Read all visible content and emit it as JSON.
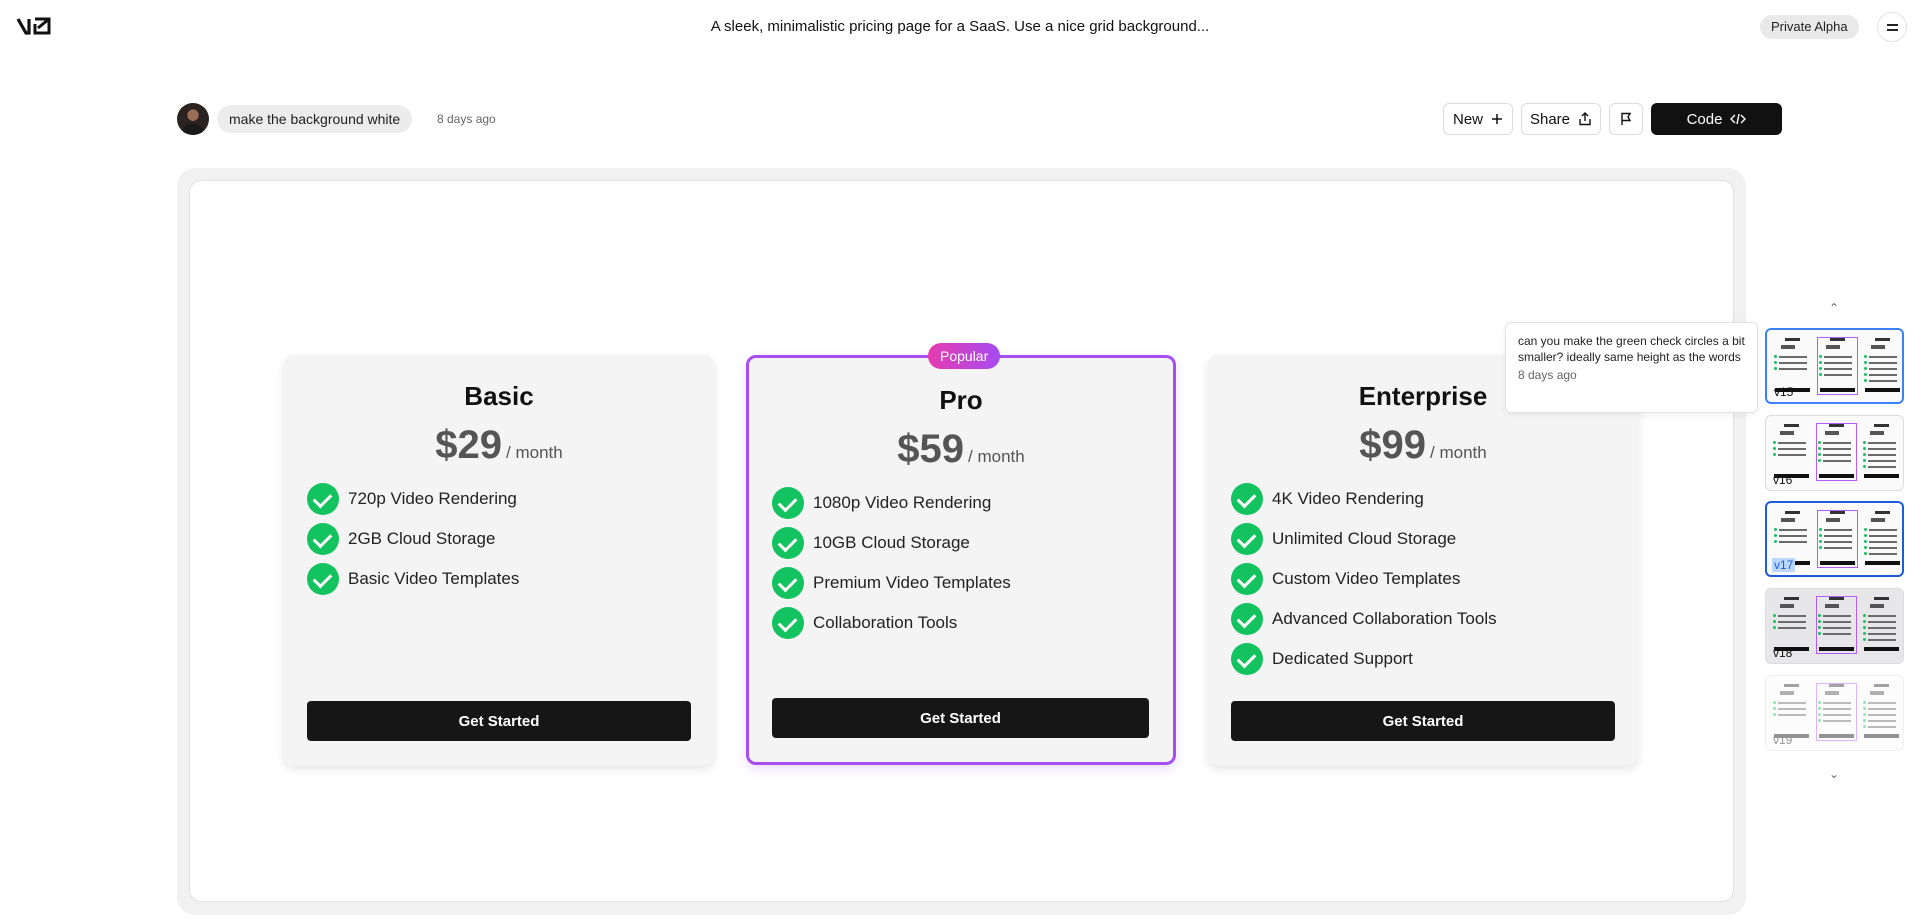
{
  "header": {
    "prompt_title": "A sleek, minimalistic pricing page for a SaaS. Use a nice grid background...",
    "badge": "Private Alpha"
  },
  "chat": {
    "message": "make the background white",
    "time": "8 days ago"
  },
  "toolbar": {
    "new_label": "New",
    "share_label": "Share",
    "code_label": "Code"
  },
  "preview": {
    "popular_badge": "Popular",
    "plans": [
      {
        "name": "Basic",
        "price": "$29",
        "period": "/ month",
        "features": [
          "720p Video Rendering",
          "2GB Cloud Storage",
          "Basic Video Templates"
        ],
        "cta": "Get Started"
      },
      {
        "name": "Pro",
        "price": "$59",
        "period": "/ month",
        "features": [
          "1080p Video Rendering",
          "10GB Cloud Storage",
          "Premium Video Templates",
          "Collaboration Tools"
        ],
        "cta": "Get Started"
      },
      {
        "name": "Enterprise",
        "price": "$99",
        "period": "/ month",
        "features": [
          "4K Video Rendering",
          "Unlimited Cloud Storage",
          "Custom Video Templates",
          "Advanced Collaboration Tools",
          "Dedicated Support"
        ],
        "cta": "Get Started"
      }
    ]
  },
  "versions": {
    "tooltip": {
      "text": "can you make the green check circles a bit smaller? ideally same height as the words",
      "time": "8 days ago"
    },
    "items": [
      {
        "label": "v15"
      },
      {
        "label": "v16"
      },
      {
        "label": "v17"
      },
      {
        "label": "v18"
      },
      {
        "label": "v19"
      }
    ]
  },
  "colors": {
    "accent_purple": "#a74ef0",
    "popular_gradient_start": "#e53cae",
    "check_green": "#13c35f",
    "button_dark": "#161616",
    "selected_blue": "#1e5bd8"
  }
}
